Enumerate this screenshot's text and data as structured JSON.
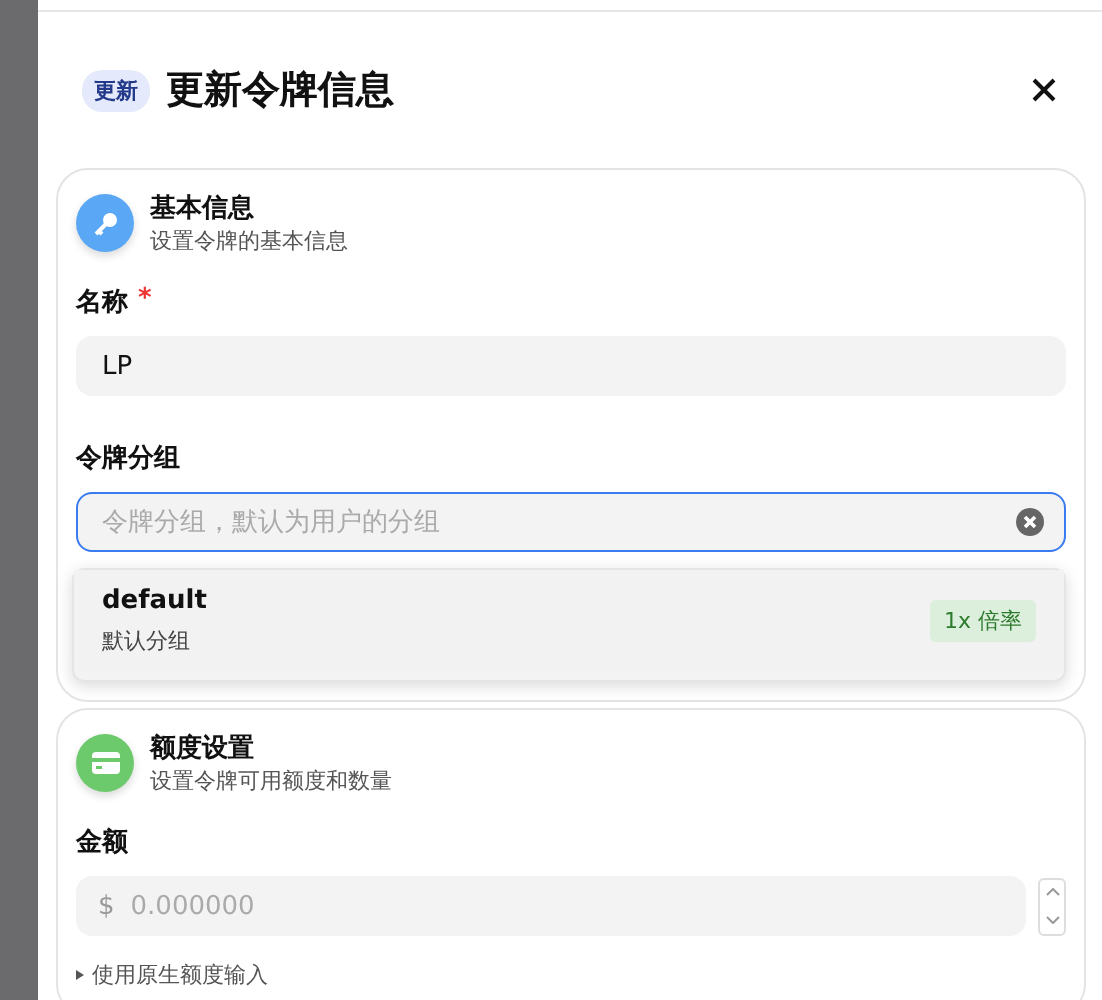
{
  "drawer": {
    "badge": "更新",
    "title": "更新令牌信息"
  },
  "sections": [
    {
      "kind": "basic",
      "title": "基本信息",
      "subtitle": "设置令牌的基本信息",
      "fields": [
        {
          "kind": "text",
          "label": "名称",
          "required_mark": "*",
          "value": "LP"
        },
        {
          "kind": "select",
          "label": "令牌分组",
          "placeholder": "令牌分组，默认为用户的分组",
          "focused": true
        }
      ]
    },
    {
      "kind": "quota",
      "title": "额度设置",
      "subtitle": "设置令牌可用额度和数量",
      "fields": [
        {
          "kind": "number",
          "label": "金额",
          "prefix": "$",
          "placeholder": "0.000000"
        }
      ],
      "toggle": "使用原生额度输入"
    }
  ],
  "dropdown": {
    "options": [
      {
        "name": "default",
        "description": "默认分组",
        "tag": "1x 倍率"
      }
    ]
  }
}
